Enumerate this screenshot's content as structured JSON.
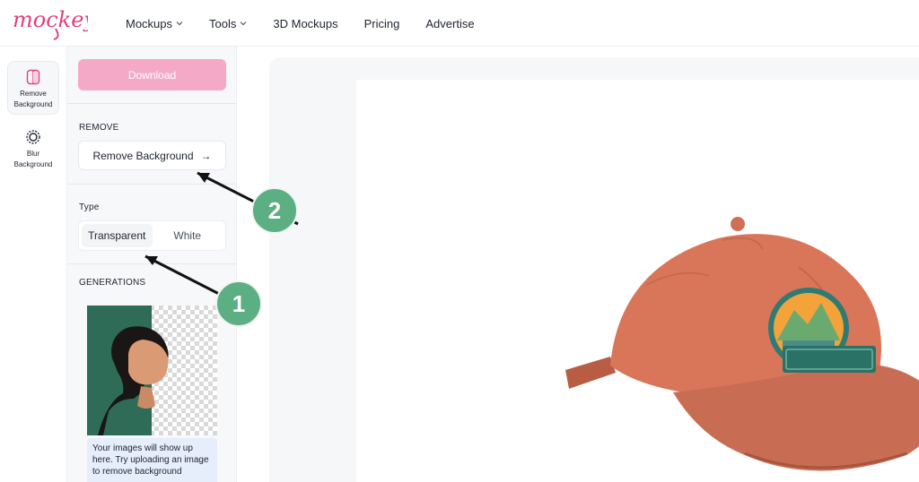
{
  "app": {
    "logo_text": "mockey"
  },
  "nav": {
    "items": [
      {
        "label": "Mockups",
        "has_dropdown": true
      },
      {
        "label": "Tools",
        "has_dropdown": true
      },
      {
        "label": "3D Mockups",
        "has_dropdown": false
      },
      {
        "label": "Pricing",
        "has_dropdown": false
      },
      {
        "label": "Advertise",
        "has_dropdown": false
      }
    ]
  },
  "rail": {
    "items": [
      {
        "label_line1": "Remove",
        "label_line2": "Background",
        "icon": "remove-background-icon",
        "active": true
      },
      {
        "label_line1": "Blur",
        "label_line2": "Background",
        "icon": "blur-background-icon",
        "active": false
      }
    ]
  },
  "panel": {
    "download_label": "Download",
    "remove_section": "REMOVE",
    "remove_button_label": "Remove Background",
    "remove_button_arrow": "→",
    "type_section": "Type",
    "type_options": [
      {
        "label": "Transparent",
        "selected": true
      },
      {
        "label": "White",
        "selected": false
      }
    ],
    "generations_section": "GENERATIONS",
    "generations_info": "Your images will show up here. Try uploading an image to remove background"
  },
  "annotations": [
    {
      "number": "1",
      "target": "type-transparent-option"
    },
    {
      "number": "2",
      "target": "remove-background-button"
    }
  ],
  "colors": {
    "brand_pink": "#e0407f",
    "download_disabled": "#f4a9c7",
    "badge_green": "#5cae83",
    "cap_color": "#d9765a"
  }
}
